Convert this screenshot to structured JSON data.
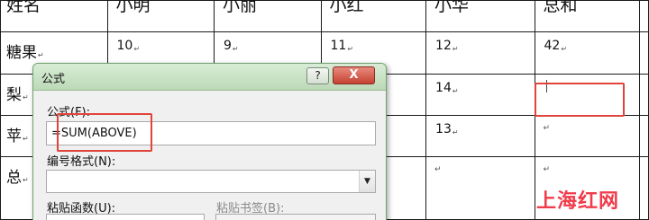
{
  "table": {
    "headers": [
      "姓名",
      "小明",
      "小丽",
      "小红",
      "小华",
      "总和"
    ],
    "rows": [
      {
        "label": "糖果",
        "values": [
          "10",
          "9",
          "11",
          "12",
          "42"
        ]
      },
      {
        "label": "梨",
        "values": [
          "",
          "",
          "",
          "14",
          ""
        ]
      },
      {
        "label": "苹",
        "values": [
          "",
          "",
          "",
          "13",
          ""
        ]
      },
      {
        "label": "总",
        "values": [
          "",
          "",
          "",
          "",
          ""
        ]
      }
    ],
    "para_mark": "↵"
  },
  "dialog": {
    "title": "公式",
    "help_label": "?",
    "close_label": "X",
    "formula_label": "公式(F):",
    "formula_value": "=SUM(ABOVE)",
    "number_format_label": "编号格式(N):",
    "number_format_value": "",
    "paste_function_label": "粘贴函数(U):",
    "paste_bookmark_label": "粘贴书签(B):"
  },
  "watermark": "上海红网",
  "colors": {
    "highlight": "#e0443c",
    "title_bar": "#bcd9b7",
    "close_button": "#c64232",
    "watermark": "#f03c4a"
  }
}
